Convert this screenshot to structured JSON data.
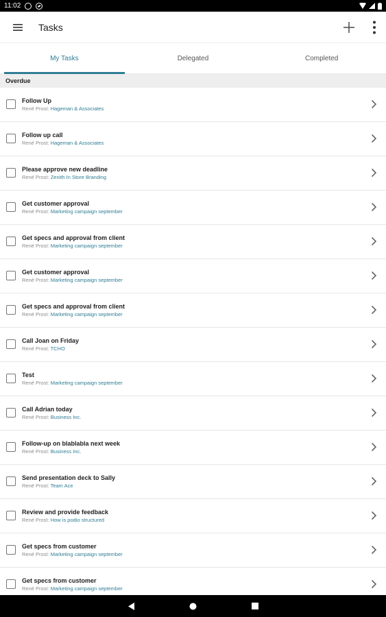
{
  "status_bar": {
    "time": "11:02"
  },
  "app_bar": {
    "title": "Tasks"
  },
  "tabs": [
    {
      "label": "My Tasks",
      "active": true
    },
    {
      "label": "Delegated",
      "active": false
    },
    {
      "label": "Completed",
      "active": false
    }
  ],
  "section": {
    "label": "Overdue"
  },
  "tasks": [
    {
      "title": "Follow Up",
      "owner": "René Prost:",
      "project": "Hageman & Associates"
    },
    {
      "title": "Follow up call",
      "owner": "René Prost:",
      "project": "Hageman & Associates"
    },
    {
      "title": "Please approve new deadline",
      "owner": "René Prost:",
      "project": "Zenith In Store Branding"
    },
    {
      "title": "Get customer approval",
      "owner": "René Prost:",
      "project": "Marketing campaign september"
    },
    {
      "title": "Get specs and approval from client",
      "owner": "René Prost:",
      "project": "Marketing campaign september"
    },
    {
      "title": "Get customer approval",
      "owner": "René Prost:",
      "project": "Marketing campaign september"
    },
    {
      "title": "Get specs and approval from client",
      "owner": "René Prost:",
      "project": "Marketing campaign september"
    },
    {
      "title": "Call Joan on Friday",
      "owner": "René Prost:",
      "project": "TCHO"
    },
    {
      "title": "Test",
      "owner": "René Prost:",
      "project": "Marketing campaign september"
    },
    {
      "title": "Call Adrian today",
      "owner": "René Prost:",
      "project": "Business Inc."
    },
    {
      "title": "Follow-up on blablabla next week",
      "owner": "René Prost:",
      "project": "Business Inc."
    },
    {
      "title": "Send presentation deck to Sally",
      "owner": "René Prost:",
      "project": "Team Ace"
    },
    {
      "title": "Review and provide feedback",
      "owner": "René Prost:",
      "project": "How is podio structured"
    },
    {
      "title": "Get specs from customer",
      "owner": "René Prost:",
      "project": "Marketing campaign september"
    },
    {
      "title": "Get specs from customer",
      "owner": "René Prost:",
      "project": "Marketing campaign september"
    }
  ],
  "icons": {
    "menu": "hamburger-icon",
    "add": "plus-icon",
    "more": "more-vert-icon",
    "row_action": "chevron-right-icon",
    "nav_back": "back-triangle-icon",
    "nav_home": "home-circle-icon",
    "nav_recents": "recents-square-icon"
  },
  "colors": {
    "accent": "#2f7d95",
    "section_bg": "#eeeeee"
  }
}
